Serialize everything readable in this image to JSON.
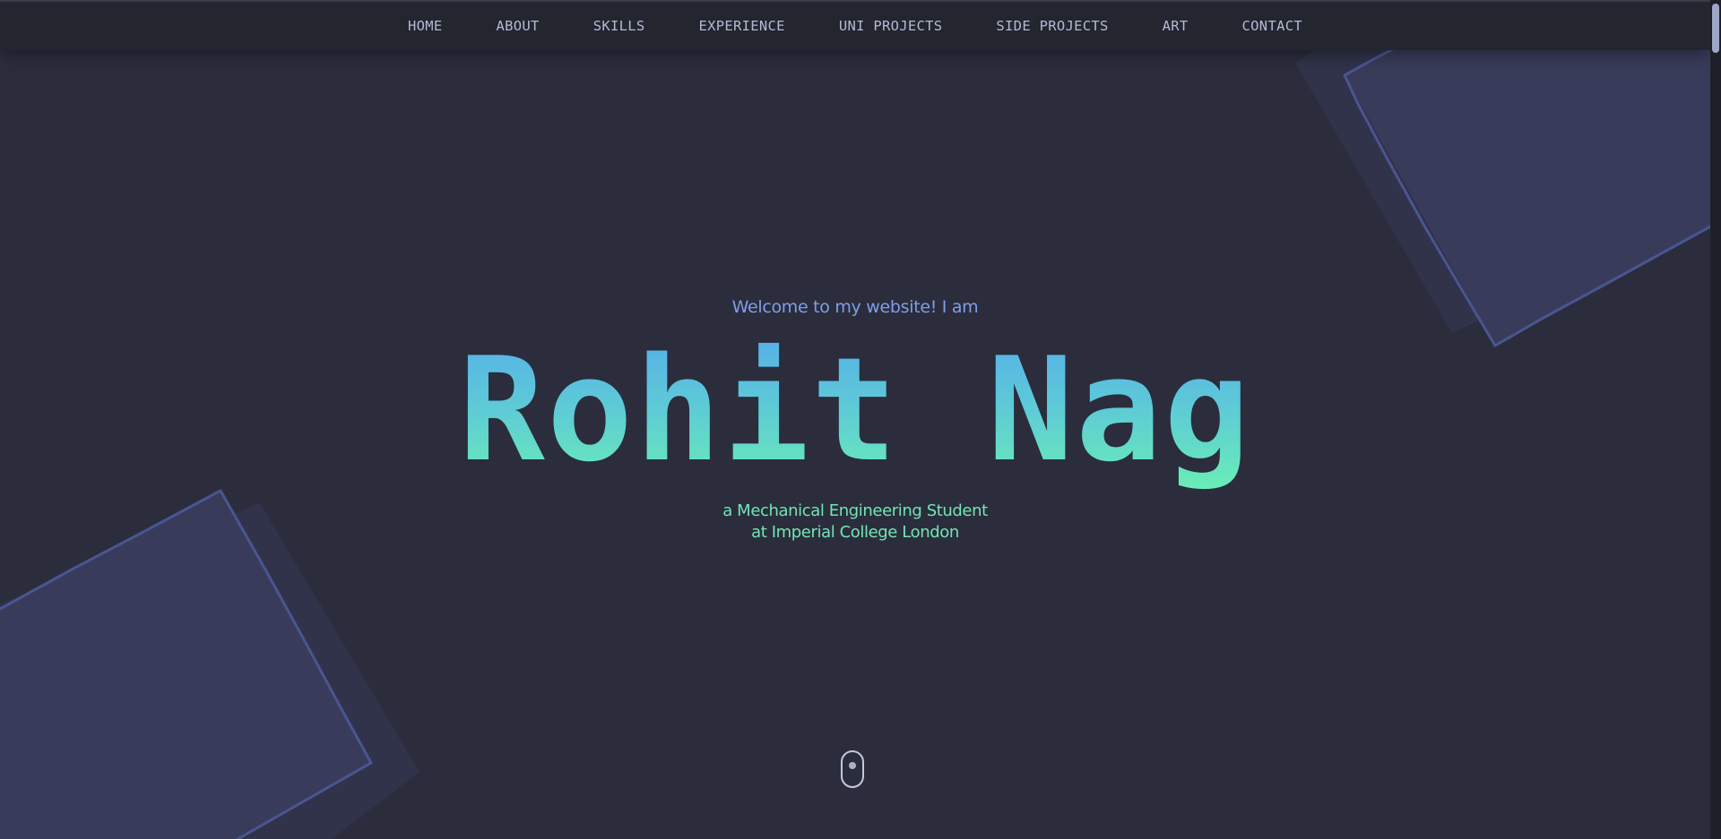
{
  "nav": {
    "items": [
      {
        "label": "HOME"
      },
      {
        "label": "ABOUT"
      },
      {
        "label": "SKILLS"
      },
      {
        "label": "EXPERIENCE"
      },
      {
        "label": "UNI PROJECTS"
      },
      {
        "label": "SIDE PROJECTS"
      },
      {
        "label": "ART"
      },
      {
        "label": "CONTACT"
      }
    ]
  },
  "hero": {
    "welcome": "Welcome to my website! I am",
    "name": "Rohit Nag",
    "tagline_line1": "a Mechanical Engineering Student",
    "tagline_line2": "at Imperial College London",
    "scroll_icon": "mouse-scroll-icon"
  },
  "colors": {
    "background": "#2b2d3d",
    "nav_background": "#23252f",
    "nav_text": "#b2bad3",
    "welcome_text": "#7f9ee6",
    "name_gradient_top": "#57aeea",
    "name_gradient_bottom": "#6aeeb6",
    "tagline_text": "#73e5b4",
    "shape_fill": "#383c5a",
    "shape_shadow": "#30334a",
    "shape_edge": "#4a5592"
  }
}
